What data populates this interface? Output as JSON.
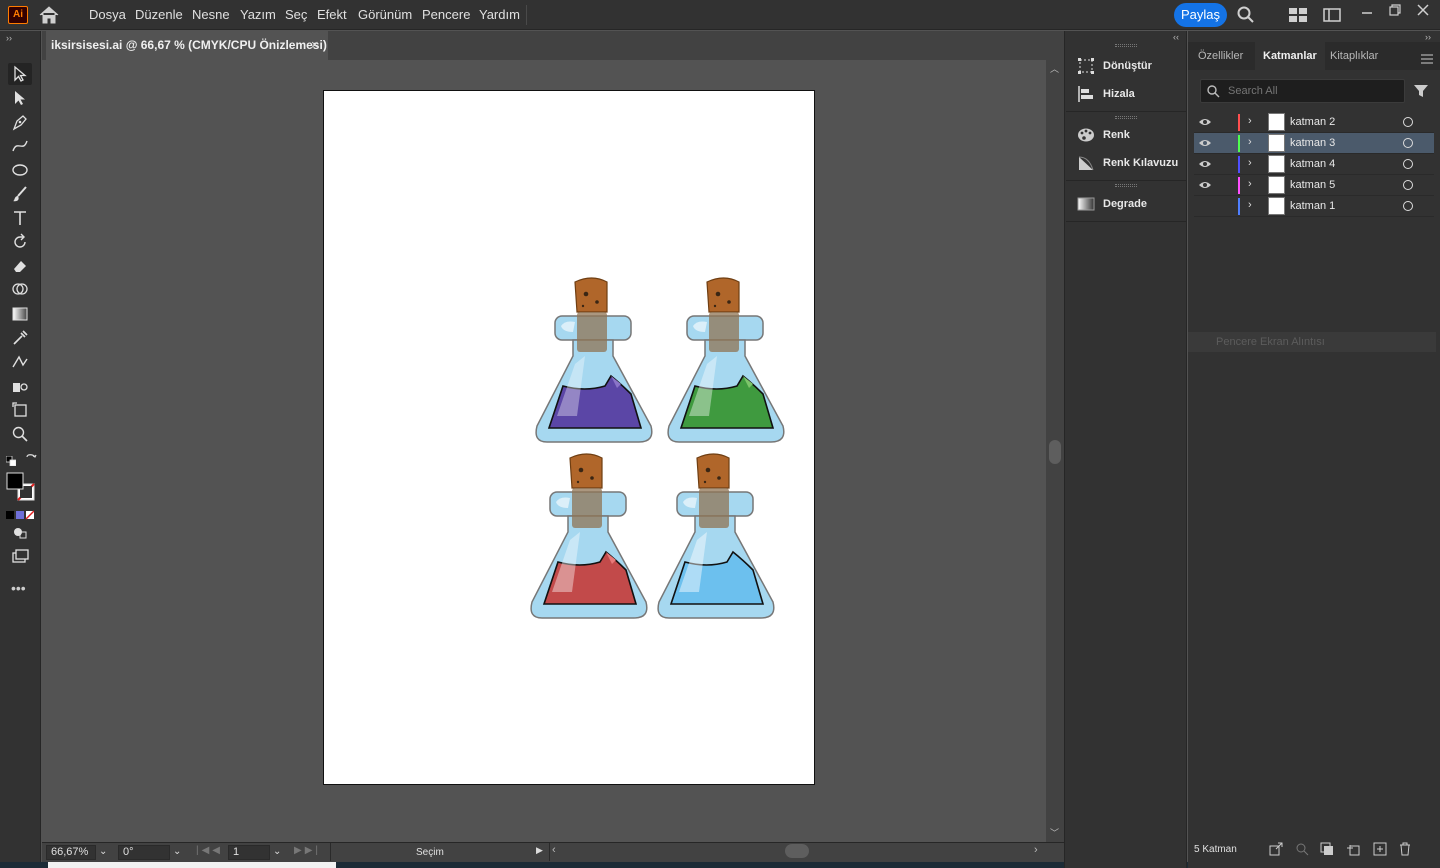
{
  "app": {
    "logo": "Ai",
    "share_label": "Paylaş"
  },
  "menu": [
    "Dosya",
    "Düzenle",
    "Nesne",
    "Yazım",
    "Seç",
    "Efekt",
    "Görünüm",
    "Pencere",
    "Yardım"
  ],
  "document": {
    "tab_title": "iksirsisesi.ai @ 66,67 % (CMYK/CPU Önizlemesi)",
    "close": "×"
  },
  "status": {
    "zoom": "66,67%",
    "rotation": "0°",
    "artboard_number": "1",
    "tool_name": "Seçim"
  },
  "mid_panel": {
    "items": [
      {
        "label": "Dönüştür",
        "icon": "transform-icon"
      },
      {
        "label": "Hizala",
        "icon": "align-icon"
      },
      {
        "label": "Renk",
        "icon": "palette-icon"
      },
      {
        "label": "Renk Kılavuzu",
        "icon": "color-guide-icon"
      },
      {
        "label": "Degrade",
        "icon": "gradient-icon"
      }
    ]
  },
  "right_panel": {
    "tabs": [
      "Özellikler",
      "Katmanlar",
      "Kitaplıklar"
    ],
    "active_tab": "Katmanlar",
    "search_placeholder": "Search All",
    "layers": [
      {
        "name": "katman 2",
        "color": "#ff4f4f",
        "visible": true,
        "selected": false
      },
      {
        "name": "katman 3",
        "color": "#4fff4f",
        "visible": true,
        "selected": true
      },
      {
        "name": "katman 4",
        "color": "#4f4fff",
        "visible": true,
        "selected": false
      },
      {
        "name": "katman 5",
        "color": "#ff4fff",
        "visible": true,
        "selected": false
      },
      {
        "name": "katman 1",
        "color": "#4f7fff",
        "visible": false,
        "selected": false
      }
    ],
    "snip_label": "Pencere Ekran Alıntısı",
    "layer_count": "5 Katman"
  },
  "artwork": {
    "potions": [
      {
        "name": "purple-potion",
        "liquid_dark": "#4b3b8f",
        "liquid_light": "#8a74c8"
      },
      {
        "name": "green-potion",
        "liquid_dark": "#2e8a2e",
        "liquid_light": "#7cc46a"
      },
      {
        "name": "red-potion",
        "liquid_dark": "#9c2c2c",
        "liquid_light": "#e87a7a"
      },
      {
        "name": "blue-potion",
        "liquid_dark": "#3aa0e0",
        "liquid_light": "#a8dcf7"
      }
    ],
    "glass_color": "#a6d8f0",
    "cork_color": "#b0662a"
  }
}
